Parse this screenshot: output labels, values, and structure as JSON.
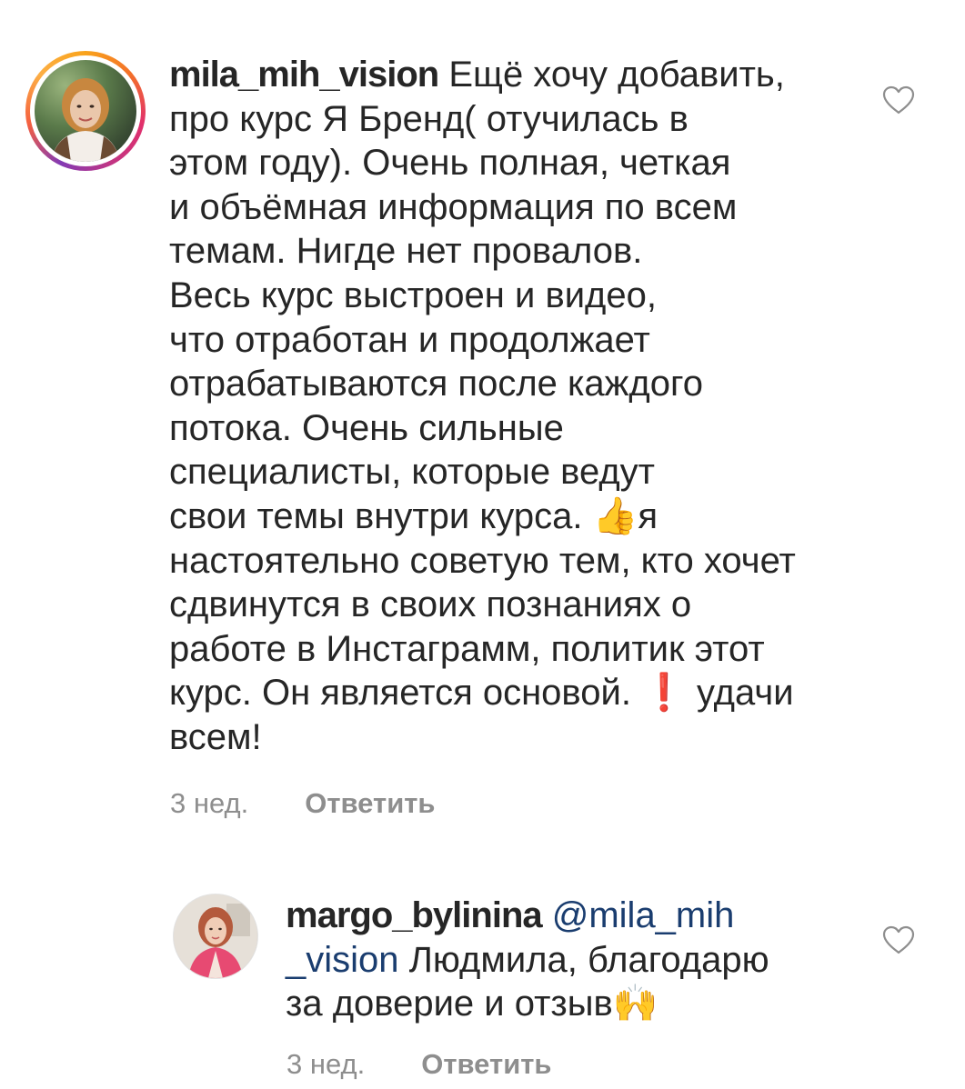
{
  "comments": [
    {
      "username": "mila_mih_vision",
      "text": " Ещё хочу добавить,\nпро курс Я Бренд( отучилась в\nэтом году). Очень полная, четкая\nи объёмная информация по всем\nтемам. Нигде нет провалов.\nВесь курс выстроен и видео,\nчто отработан и продолжает\nотрабатываются после каждого\nпотока. Очень сильные\nспециалисты, которые ведут\nсвои темы внутри курса. ",
      "emoji_thumbs": "👍",
      "text_b": "я\nнастоятельно советую тем, кто хочет\nсдвинутся в своих познаниях о\nработе в Инстаграмм, политик этот\nкурс. Он является основой. ",
      "emoji_exclaim": "❗",
      "text_c": " удачи\nвсем!",
      "time": "3 нед.",
      "reply_label": "Ответить",
      "icon": "heart-outline"
    },
    {
      "username": "margo_bylinina",
      "mention": " @mila_mih\n_vision",
      "text": " Людмила, благодарю\nза доверие и отзыв",
      "emoji_hands": "🙌",
      "time": "3 нед.",
      "reply_label": "Ответить",
      "icon": "heart-outline"
    }
  ],
  "colors": {
    "text": "#262626",
    "meta": "#8e8e8e",
    "mention": "#1a3d6f",
    "story_ring": "#e1306c"
  }
}
